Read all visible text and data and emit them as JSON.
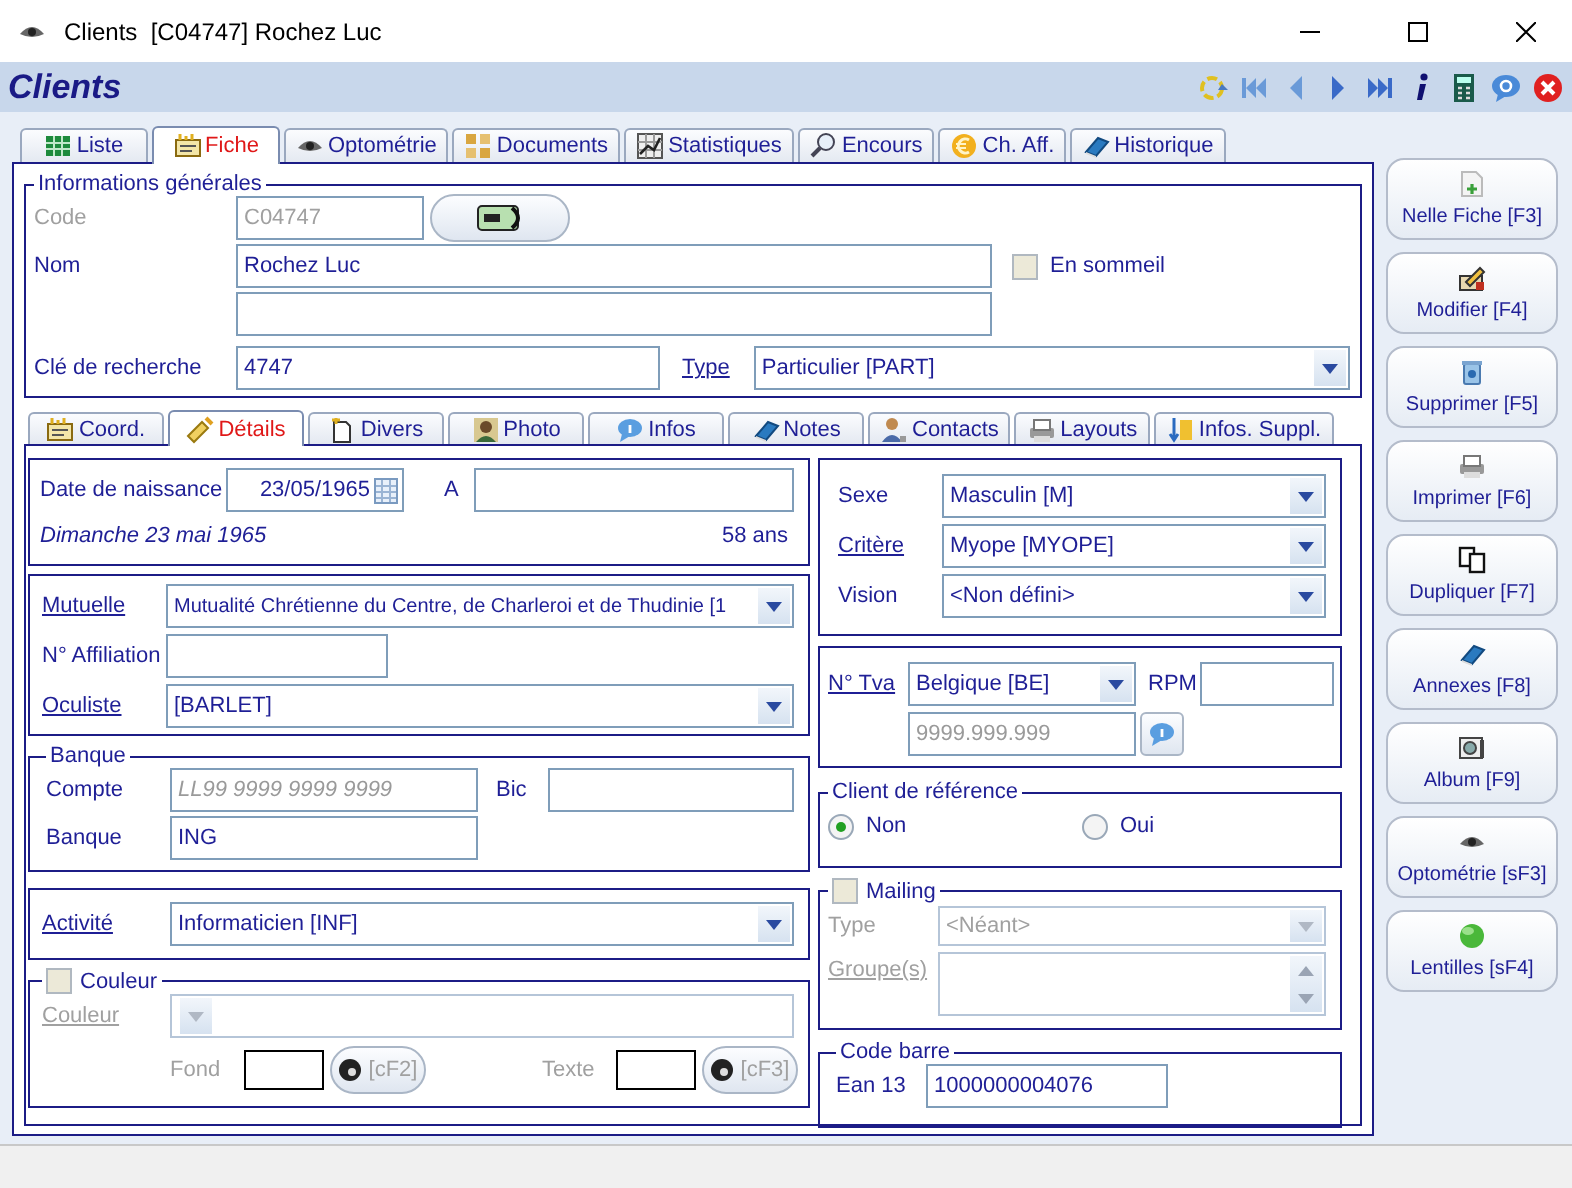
{
  "window": {
    "title": "Clients  [C04747] Rochez Luc"
  },
  "header": {
    "title": "Clients"
  },
  "tabs": [
    {
      "label": "Liste",
      "selected": false
    },
    {
      "label": "Fiche",
      "selected": true
    },
    {
      "label": "Optométrie",
      "selected": false
    },
    {
      "label": "Documents",
      "selected": false
    },
    {
      "label": "Statistiques",
      "selected": false
    },
    {
      "label": "Encours",
      "selected": false
    },
    {
      "label": "Ch. Aff.",
      "selected": false
    },
    {
      "label": "Historique",
      "selected": false
    }
  ],
  "general": {
    "legend": "Informations générales",
    "code_label": "Code",
    "code": "C04747",
    "name_label": "Nom",
    "name": "Rochez Luc",
    "dormant": {
      "label": "En sommeil",
      "checked": false
    },
    "search_key_label": "Clé de recherche",
    "search_key": "4747",
    "type_label": "Type",
    "type": "Particulier [PART]"
  },
  "subtabs": [
    {
      "label": "Coord.",
      "selected": false
    },
    {
      "label": "Détails",
      "selected": true
    },
    {
      "label": "Divers",
      "selected": false
    },
    {
      "label": "Photo",
      "selected": false
    },
    {
      "label": "Infos",
      "selected": false
    },
    {
      "label": "Notes",
      "selected": false
    },
    {
      "label": "Contacts",
      "selected": false
    },
    {
      "label": "Layouts",
      "selected": false
    },
    {
      "label": "Infos. Suppl.",
      "selected": false
    }
  ],
  "birth": {
    "label": "Date de naissance",
    "date": "23/05/1965",
    "place_label": "A",
    "day_text": "Dimanche 23 mai 1965",
    "age": "58 ans"
  },
  "insurance": {
    "label": "Mutuelle",
    "value": "Mutualité Chrétienne du Centre, de Charleroi et de Thudinie [1",
    "affiliation_label": "N° Affiliation",
    "oculist_label": "Oculiste",
    "oculist": "[BARLET]"
  },
  "bank": {
    "legend": "Banque",
    "account_label": "Compte",
    "account_placeholder": "LL99 9999 9999 9999",
    "bic_label": "Bic",
    "bank_label": "Banque",
    "bank": "ING"
  },
  "activity": {
    "label": "Activité",
    "value": "Informaticien [INF]"
  },
  "color": {
    "legend": "Couleur",
    "checked": false,
    "label": "Couleur",
    "background_label": "Fond",
    "background_button": "[cF2]",
    "text_label": "Texte",
    "text_button": "[cF3]"
  },
  "profile": [
    {
      "label": "Sexe",
      "link": false,
      "value": "Masculin [M]"
    },
    {
      "label": "Critère",
      "link": true,
      "value": "Myope [MYOPE]"
    },
    {
      "label": "Vision",
      "link": false,
      "value": "<Non défini>"
    }
  ],
  "vat": {
    "label": "N° Tva",
    "country": "Belgique [BE]",
    "rpm_label": "RPM",
    "placeholder": "9999.999.999"
  },
  "reference": {
    "legend": "Client de référence",
    "options": [
      {
        "label": "Non",
        "selected": true
      },
      {
        "label": "Oui",
        "selected": false
      }
    ]
  },
  "mailing": {
    "legend": "Mailing",
    "checked": false,
    "type_label": "Type",
    "type": "<Néant>",
    "groups_label": "Groupe(s)"
  },
  "barcode": {
    "legend": "Code barre",
    "label": "Ean 13",
    "value": "1000000004076"
  },
  "actions": [
    "Nelle Fiche [F3]",
    "Modifier [F4]",
    "Supprimer [F5]",
    "Imprimer [F6]",
    "Dupliquer [F7]",
    "Annexes [F8]",
    "Album [F9]",
    "Optométrie [sF3]",
    "Lentilles [sF4]"
  ]
}
